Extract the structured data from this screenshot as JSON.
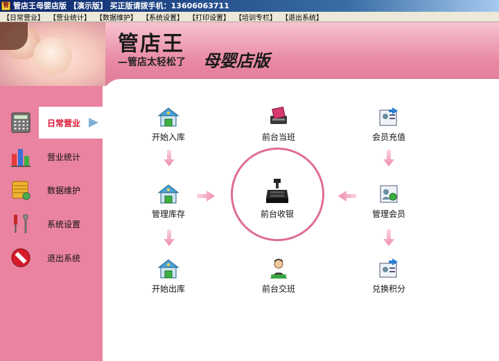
{
  "window": {
    "title": "管店王母婴店版 【演示版】 买正版请拨手机：13606063711"
  },
  "menu": [
    "【日常营业】",
    "【营业统计】",
    "【数据维护】",
    "【系统设置】",
    "【打印设置】",
    "【培训专栏】",
    "【退出系统】"
  ],
  "banner": {
    "logo": "管店王",
    "slogan": "—管店太轻松了",
    "edition": "母婴店版"
  },
  "sidebar": {
    "items": [
      {
        "label": "日常营业",
        "icon": "calculator-icon",
        "active": true
      },
      {
        "label": "营业统计",
        "icon": "bar-chart-icon",
        "active": false
      },
      {
        "label": "数据维护",
        "icon": "database-icon",
        "active": false
      },
      {
        "label": "系统设置",
        "icon": "tools-icon",
        "active": false
      },
      {
        "label": "退出系统",
        "icon": "no-entry-icon",
        "active": false
      }
    ]
  },
  "functions": {
    "stock_in": {
      "label": "开始入库",
      "icon": "warehouse-icon"
    },
    "shift_start": {
      "label": "前台当班",
      "icon": "card-reader-icon"
    },
    "member_recharge": {
      "label": "会员充值",
      "icon": "member-card-in-icon"
    },
    "manage_stock": {
      "label": "管理库存",
      "icon": "warehouse-icon"
    },
    "cashier": {
      "label": "前台收银",
      "icon": "cash-register-icon"
    },
    "manage_members": {
      "label": "管理会员",
      "icon": "member-card-icon"
    },
    "stock_out": {
      "label": "开始出库",
      "icon": "warehouse-icon"
    },
    "shift_handover": {
      "label": "前台交班",
      "icon": "person-icon"
    },
    "redeem_points": {
      "label": "兑换积分",
      "icon": "member-card-out-icon"
    }
  },
  "colors": {
    "sidebar_pink": "#e9839f",
    "arrow_pink": "#f2a6bf",
    "ring_pink": "#e06c8e",
    "active_text": "#d8102e",
    "title_bar": "#0a246a"
  }
}
